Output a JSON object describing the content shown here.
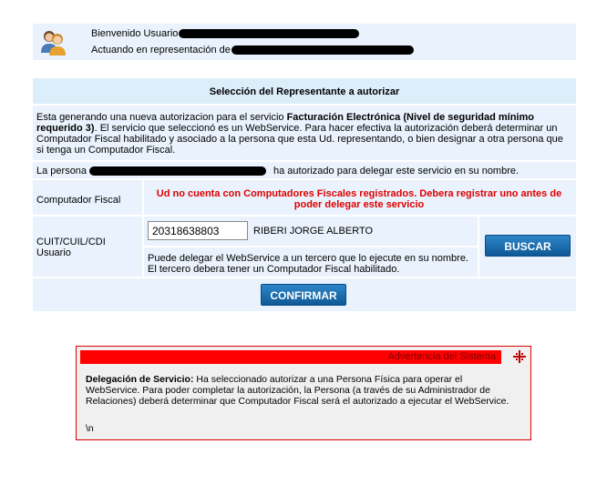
{
  "header": {
    "welcome_text": "Bienvenido Usuario",
    "acting_text": "Actuando en representación de"
  },
  "panel": {
    "title": "Selección del Representante a autorizar",
    "intro_prefix": "Esta generando una nueva autorizacion para el servicio ",
    "intro_service": "Facturación Electrónica (Nivel de seguridad mínimo requerido 3)",
    "intro_suffix": ". El servicio que seleccionó es un WebService. Para hacer efectiva la autorización deberá determinar un Computador Fiscal habilitado y asociado a la persona que esta Ud. representando, o bien designar a otra persona que si tenga un Computador Fiscal.",
    "persona_prefix": "La persona",
    "persona_suffix": "ha autorizado para delegar este servicio en su nombre.",
    "computador_label": "Computador Fiscal",
    "computador_warning": "Ud no cuenta con Computadores Fiscales registrados. Debera registrar uno antes de poder delegar este servicio",
    "cuit_label": "CUIT/CUIL/CDI Usuario",
    "cuit_value": "20318638803",
    "cuit_name": "RIBERI JORGE ALBERTO",
    "delegate_note": "Puede delegar el WebService a un tercero que lo ejecute en su nombre. El tercero debera tener un Computador Fiscal habilitado.",
    "buscar_label": "BUSCAR",
    "confirmar_label": "CONFIRMAR"
  },
  "system_warning": {
    "title": "Advertencia del Sistema",
    "heading": "Delegación de Servicio:",
    "body": " Ha seleccionado autorizar a una Persona Física para operar el WebService. Para poder completar la autorización, la Persona (a través de su Administrador de Relaciones) deberá determinar que Computador Fiscal será el autorizado a ejecutar el WebService.",
    "extra": "\\n"
  },
  "colors": {
    "panel_bg": "#eaf3fd",
    "warning_red": "#e00000",
    "button_blue": "#1a6aab"
  },
  "icons": {
    "avatar": "users-icon",
    "sys_icon": "move-icon"
  }
}
